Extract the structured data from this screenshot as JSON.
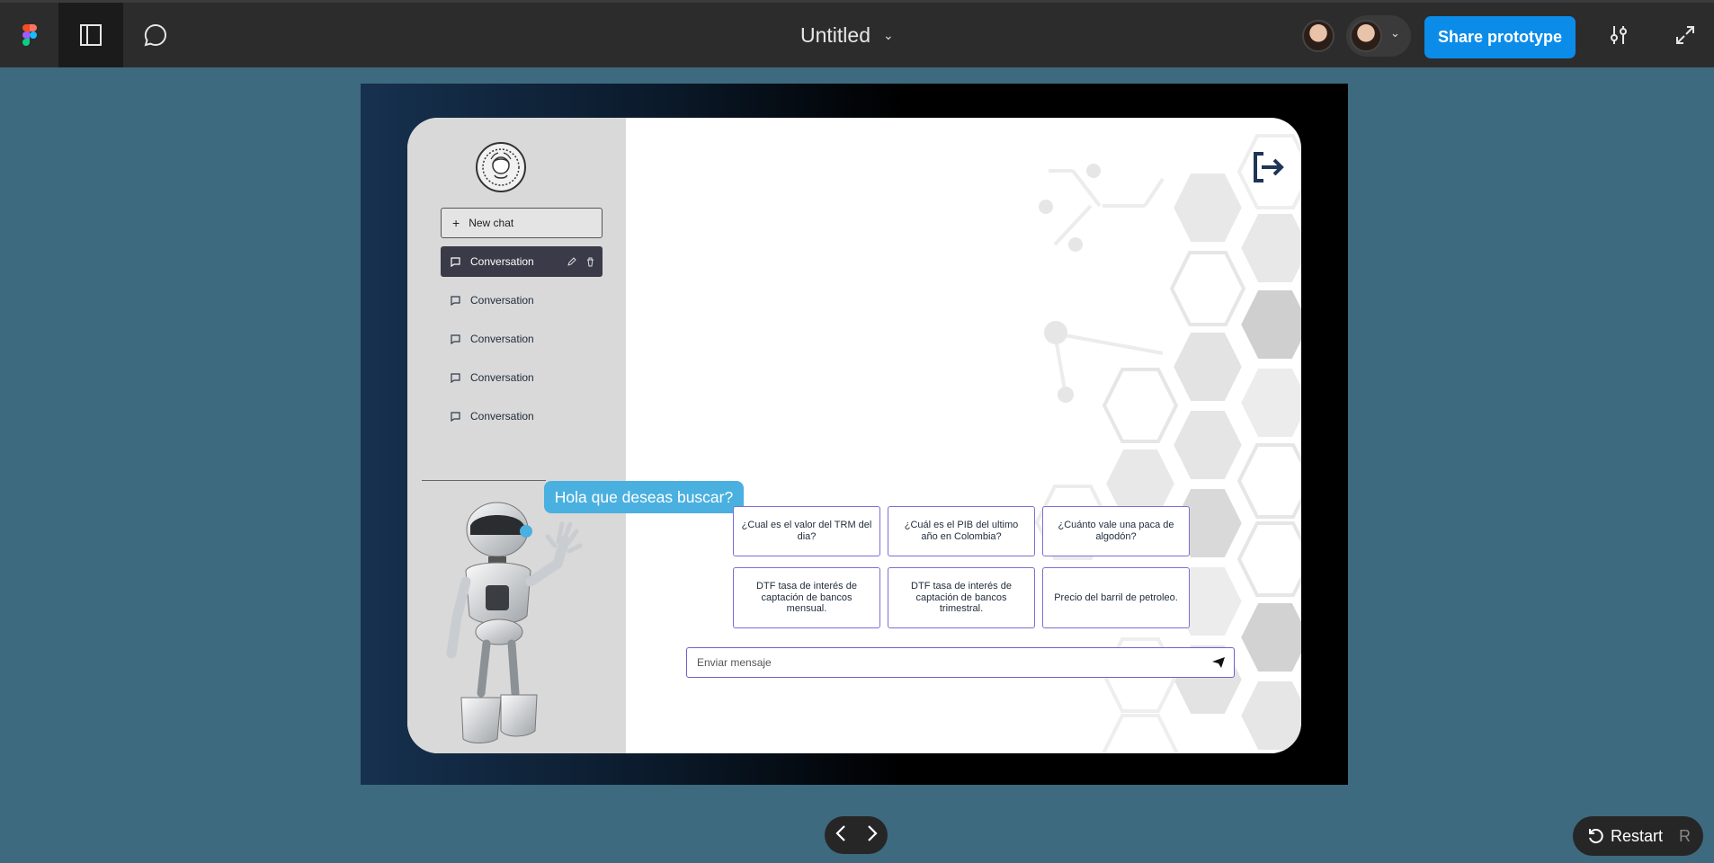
{
  "topbar": {
    "file_title": "Untitled",
    "share_label": "Share prototype"
  },
  "sidebar": {
    "new_chat_label": "New chat",
    "conversations": [
      {
        "label": "Conversation",
        "active": true
      },
      {
        "label": "Conversation",
        "active": false
      },
      {
        "label": "Conversation",
        "active": false
      },
      {
        "label": "Conversation",
        "active": false
      },
      {
        "label": "Conversation",
        "active": false
      }
    ]
  },
  "chat": {
    "greeting": "Hola que deseas buscar?",
    "suggestions": [
      "¿Cual es el  valor del TRM del dia?",
      "¿Cuál es el PIB del ultimo año en Colombia?",
      "¿Cuánto vale una paca de algodón?",
      "DTF tasa de interés de captación de bancos mensual.",
      "DTF tasa de interés de captación de bancos trimestral.",
      "Precio del barril de petroleo."
    ],
    "input_placeholder": "Enviar mensaje"
  },
  "bottom": {
    "restart_label": "Restart",
    "restart_shortcut": "R"
  },
  "colors": {
    "canvas": "#3d6a7e",
    "accent_blue": "#0c8ce9",
    "bubble": "#4ab0e0",
    "suggestion_border": "#7b6fd6"
  },
  "icons": [
    "figma-logo",
    "sidebar-icon",
    "comment-icon",
    "chevron-down-icon",
    "settings-sliders-icon",
    "fullscreen-icon",
    "plus-icon",
    "chat-bubble-icon",
    "edit-icon",
    "trash-icon",
    "logout-icon",
    "send-icon",
    "chevron-left-icon",
    "chevron-right-icon",
    "restart-icon"
  ]
}
